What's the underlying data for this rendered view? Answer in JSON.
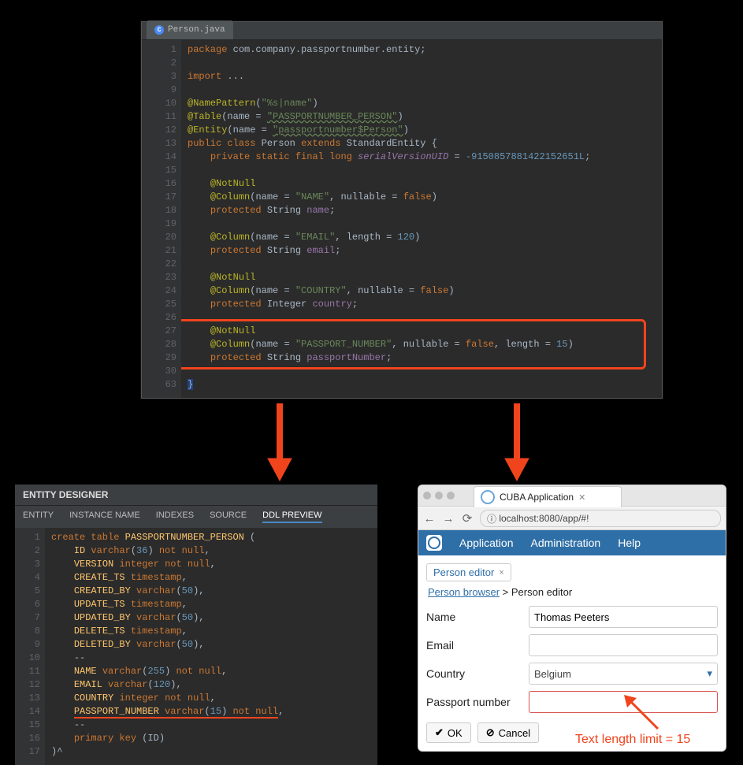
{
  "top_editor": {
    "tab_filename": "Person.java",
    "tab_icon": "C",
    "line_numbers": [
      "1",
      "2",
      "3",
      "9",
      "10",
      "11",
      "12",
      "13",
      "14",
      "15",
      "16",
      "17",
      "18",
      "19",
      "20",
      "21",
      "22",
      "23",
      "24",
      "25",
      "26",
      "27",
      "28",
      "29",
      "30",
      "63"
    ],
    "code": {
      "l1": {
        "kw": "package",
        "pkg": "com.company.passportnumber.entity",
        "semi": ";"
      },
      "l3": {
        "kw": "import",
        "rest": "...",
        "semi": ""
      },
      "l10": {
        "ann": "@NamePattern",
        "open": "(",
        "str": "\"%s|name\"",
        "close": ")"
      },
      "l11": {
        "ann": "@Table",
        "open": "(",
        "key": "name",
        "eq": " = ",
        "str": "\"PASSPORTNUMBER_PERSON\"",
        "close": ")"
      },
      "l12": {
        "ann": "@Entity",
        "open": "(",
        "key": "name",
        "eq": " = ",
        "str": "\"passportnumber$Person\"",
        "close": ")"
      },
      "l13": {
        "kw1": "public",
        "kw2": "class",
        "cls": "Person",
        "kw3": "extends",
        "sup": "StandardEntity",
        "brace": "{"
      },
      "l14": {
        "mods": "private static final long",
        "id": "serialVersionUID",
        "eq": " = ",
        "num": "-9150857881422152651L",
        "semi": ";"
      },
      "l16": {
        "ann": "@NotNull"
      },
      "l17": {
        "ann": "@Column",
        "open": "(",
        "k1": "name",
        "eq1": " = ",
        "s1": "\"NAME\"",
        "c1": ", ",
        "k2": "nullable",
        "eq2": " = ",
        "b2": "false",
        "close": ")"
      },
      "l18": {
        "mod": "protected",
        "type": "String",
        "id": "name",
        "semi": ";"
      },
      "l20": {
        "ann": "@Column",
        "open": "(",
        "k1": "name",
        "eq1": " = ",
        "s1": "\"EMAIL\"",
        "c1": ", ",
        "k2": "length",
        "eq2": " = ",
        "n2": "120",
        "close": ")"
      },
      "l21": {
        "mod": "protected",
        "type": "String",
        "id": "email",
        "semi": ";"
      },
      "l23": {
        "ann": "@NotNull"
      },
      "l24": {
        "ann": "@Column",
        "open": "(",
        "k1": "name",
        "eq1": " = ",
        "s1": "\"COUNTRY\"",
        "c1": ", ",
        "k2": "nullable",
        "eq2": " = ",
        "b2": "false",
        "close": ")"
      },
      "l25": {
        "mod": "protected",
        "type": "Integer",
        "id": "country",
        "semi": ";"
      },
      "l27": {
        "ann": "@NotNull"
      },
      "l28": {
        "ann": "@Column",
        "open": "(",
        "k1": "name",
        "eq1": " = ",
        "s1": "\"PASSPORT_NUMBER\"",
        "c1": ", ",
        "k2": "nullable",
        "eq2": " = ",
        "b2": "false",
        "c2": ", ",
        "k3": "length",
        "eq3": " = ",
        "n3": "15",
        "close": ")"
      },
      "l29": {
        "mod": "protected",
        "type": "String",
        "id": "passportNumber",
        "semi": ";"
      },
      "l63": {
        "brace": "}"
      }
    }
  },
  "designer": {
    "title": "ENTITY DESIGNER",
    "tabs": {
      "t1": "ENTITY",
      "t2": "INSTANCE NAME",
      "t3": "INDEXES",
      "t4": "SOURCE",
      "t5": "DDL PREVIEW"
    },
    "line_numbers": [
      "1",
      "2",
      "3",
      "4",
      "5",
      "6",
      "7",
      "8",
      "9",
      "10",
      "11",
      "12",
      "13",
      "14",
      "15",
      "16",
      "17"
    ],
    "ddl": {
      "l1": {
        "kw": "create table",
        "id": "PASSPORTNUMBER_PERSON",
        "p": " ("
      },
      "l2": {
        "id": "ID",
        "t": "varchar",
        "open": "(",
        "n": "36",
        "close": ")",
        "nn": "not null",
        "comma": ","
      },
      "l3": {
        "id": "VERSION",
        "t": "integer",
        "nn": "not null",
        "comma": ","
      },
      "l4": {
        "id": "CREATE_TS",
        "t": "timestamp",
        "comma": ","
      },
      "l5": {
        "id": "CREATED_BY",
        "t": "varchar",
        "open": "(",
        "n": "50",
        "close": ")",
        "comma": ","
      },
      "l6": {
        "id": "UPDATE_TS",
        "t": "timestamp",
        "comma": ","
      },
      "l7": {
        "id": "UPDATED_BY",
        "t": "varchar",
        "open": "(",
        "n": "50",
        "close": ")",
        "comma": ","
      },
      "l8": {
        "id": "DELETE_TS",
        "t": "timestamp",
        "comma": ","
      },
      "l9": {
        "id": "DELETED_BY",
        "t": "varchar",
        "open": "(",
        "n": "50",
        "close": ")",
        "comma": ","
      },
      "l10": {
        "sep": "--"
      },
      "l11": {
        "id": "NAME",
        "t": "varchar",
        "open": "(",
        "n": "255",
        "close": ")",
        "nn": "not null",
        "comma": ","
      },
      "l12": {
        "id": "EMAIL",
        "t": "varchar",
        "open": "(",
        "n": "120",
        "close": ")",
        "comma": ","
      },
      "l13": {
        "id": "COUNTRY",
        "t": "integer",
        "nn": "not null",
        "comma": ","
      },
      "l14": {
        "id": "PASSPORT_NUMBER",
        "t": "varchar",
        "open": "(",
        "n": "15",
        "close": ")",
        "nn": "not null",
        "comma": ","
      },
      "l15": {
        "sep": "--"
      },
      "l16": {
        "kw": "primary key",
        "p": " (ID)"
      },
      "l17": {
        "p": ")^"
      }
    }
  },
  "browser": {
    "page_title": "CUBA Application",
    "url": "localhost:8080/app/#!",
    "menu": {
      "app": "Application",
      "admin": "Administration",
      "help": "Help"
    },
    "view_tab": "Person editor",
    "crumb_link": "Person browser",
    "crumb_sep": " > ",
    "crumb_cur": "Person editor",
    "form": {
      "name_label": "Name",
      "name_value": "Thomas Peeters",
      "email_label": "Email",
      "email_value": "",
      "country_label": "Country",
      "country_value": "Belgium",
      "passport_label": "Passport number",
      "passport_value": ""
    },
    "buttons": {
      "ok": "OK",
      "cancel": "Cancel"
    }
  },
  "annotation": "Text length limit = 15"
}
